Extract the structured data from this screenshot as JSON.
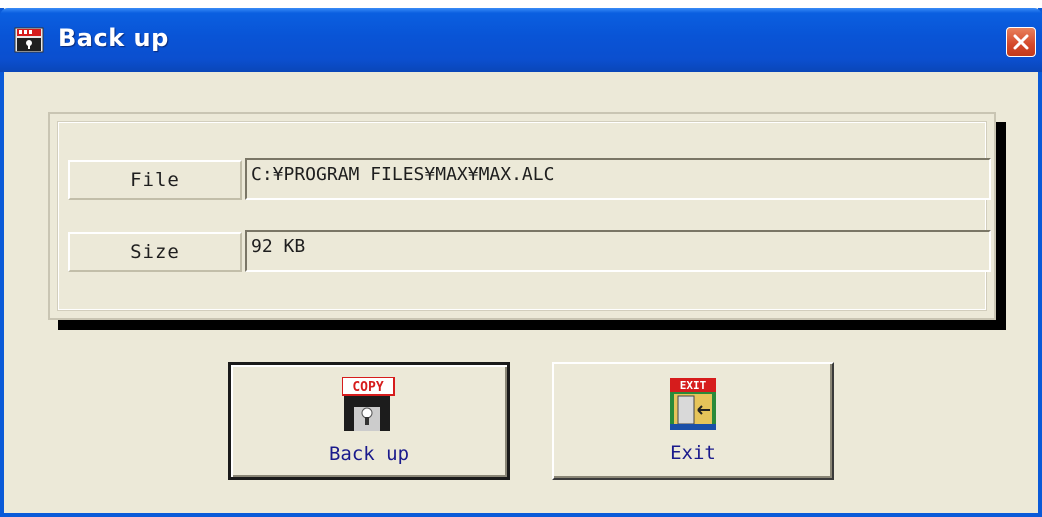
{
  "window": {
    "title": "Back up",
    "app_icon": "floppy-app-icon",
    "close_icon": "close-x-icon"
  },
  "fields": [
    {
      "label": "File",
      "value": "C:¥PROGRAM FILES¥MAX¥MAX.ALC"
    },
    {
      "label": "Size",
      "value": "92 KB"
    }
  ],
  "buttons": {
    "backup": {
      "label": "Back up",
      "icon": "copy-floppy-icon",
      "icon_text": "COPY"
    },
    "exit": {
      "label": "Exit",
      "icon": "exit-door-icon",
      "icon_text": "EXIT"
    }
  },
  "colors": {
    "titlebar": "#0954d6",
    "window_bg": "#ece9d8",
    "close_button": "#d4482a",
    "button_label": "#1a1a8c"
  }
}
